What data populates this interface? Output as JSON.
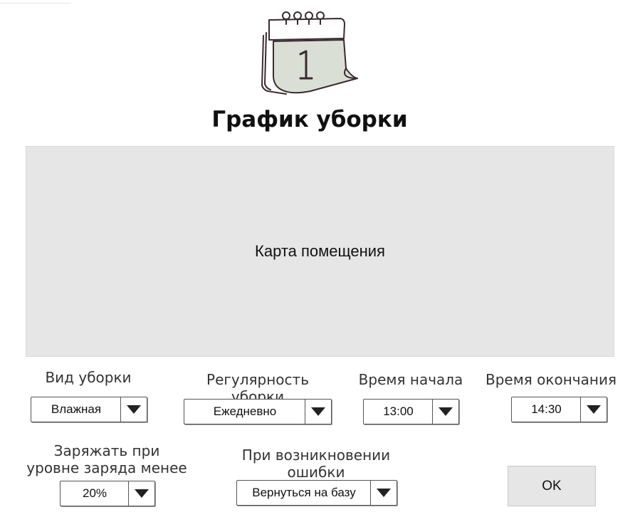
{
  "header": {
    "title": "График уборки",
    "icon": "calendar-icon"
  },
  "map": {
    "label": "Карта помещения"
  },
  "settings": {
    "cleaning_type": {
      "label": "Вид уборки",
      "value": "Влажная"
    },
    "regularity": {
      "label": "Регулярность уборки",
      "value": "Ежедневно"
    },
    "start_time": {
      "label": "Время начала",
      "value": "13:00"
    },
    "end_time": {
      "label": "Время окончания",
      "value": "14:30"
    },
    "charge_level": {
      "label_line1": "Заряжать при",
      "label_line2": "уровне заряда менее",
      "value": "20%"
    },
    "on_error": {
      "label_line1": "При возникновении",
      "label_line2": "ошибки",
      "value": "Вернуться на базу"
    }
  },
  "actions": {
    "ok_label": "OK"
  },
  "colors": {
    "map_bg": "#e6e6e6",
    "button_bg": "#e6e6e6",
    "text": "#222222"
  }
}
